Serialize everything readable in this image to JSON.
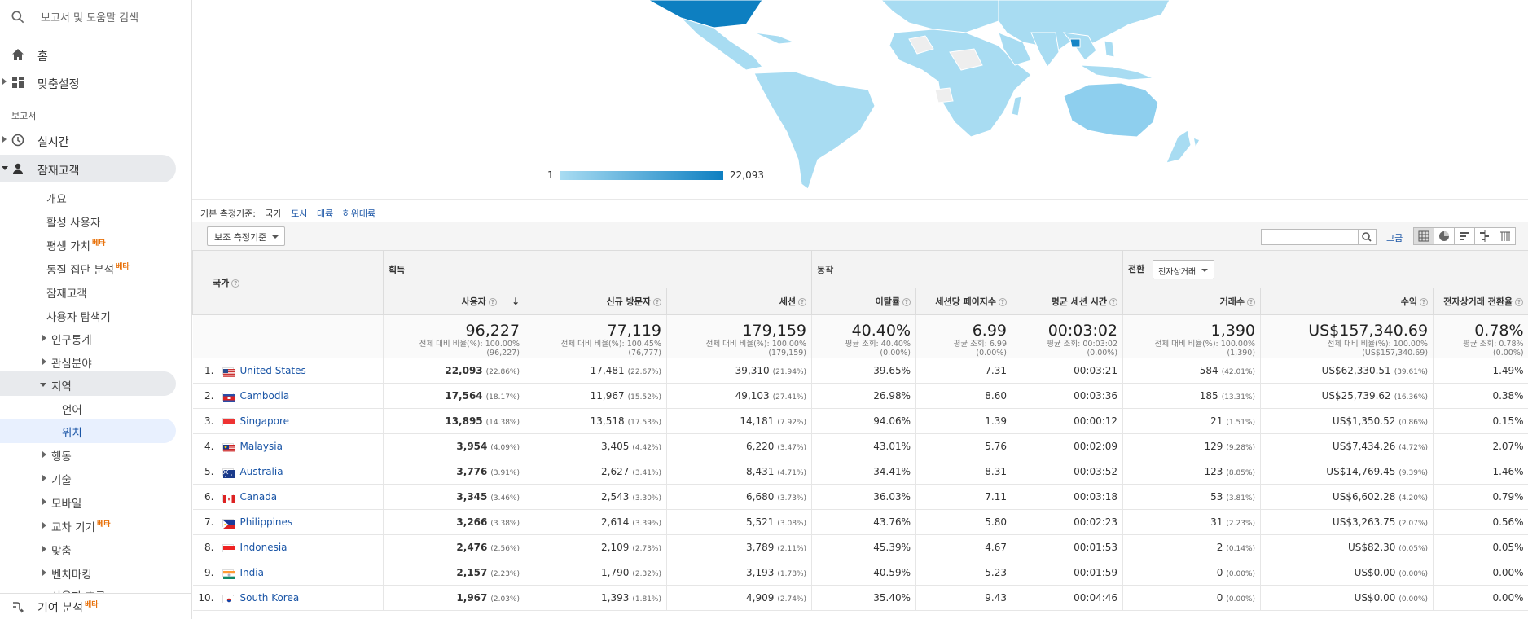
{
  "sidebar": {
    "search_placeholder": "보고서 및 도움말 검색",
    "home": "홈",
    "customization": "맞춤설정",
    "reports_section": "보고서",
    "realtime": "실시간",
    "audience": "잠재고객",
    "audience_items": [
      {
        "label": "개요"
      },
      {
        "label": "활성 사용자"
      },
      {
        "label": "평생 가치",
        "beta": "베타"
      },
      {
        "label": "동질 집단 분석",
        "beta": "베타"
      },
      {
        "label": "잠재고객"
      },
      {
        "label": "사용자 탐색기"
      }
    ],
    "demographics": "인구통계",
    "interests": "관심분야",
    "geo": "지역",
    "language": "언어",
    "location": "위치",
    "behavior": "행동",
    "technology": "기술",
    "mobile": "모바일",
    "cross_device": "교차 기기",
    "cross_device_beta": "베타",
    "custom": "맞춤",
    "benchmarking": "벤치마킹",
    "cutoff_item": "사용자 흐름",
    "attribution": "기여 분석",
    "attribution_beta": "베타"
  },
  "map": {
    "legend_min": "1",
    "legend_max": "22,093",
    "colors": {
      "low": "#a8dcf2",
      "high": "#0d7fc1",
      "nodata": "#eeeeee"
    }
  },
  "dimension_bar": {
    "label": "기본 측정기준:",
    "active": "국가",
    "links": [
      "도시",
      "대륙",
      "하위대륙"
    ]
  },
  "toolbar": {
    "secondary_dim": "보조 측정기준",
    "advanced": "고급"
  },
  "table": {
    "country_header": "국가",
    "groups": {
      "acquisition": "획득",
      "behavior": "동작",
      "conversion": "전환",
      "conversion_select": "전자상거래"
    },
    "columns": [
      "사용자",
      "신규 방문자",
      "세션",
      "이탈률",
      "세션당 페이지수",
      "평균 세션 시간",
      "거래수",
      "수익",
      "전자상거래 전환율"
    ],
    "totals": [
      {
        "big": "96,227",
        "sub1": "전체 대비 비율(%): 100.00%",
        "sub2": "(96,227)"
      },
      {
        "big": "77,119",
        "sub1": "전체 대비 비율(%): 100.45%",
        "sub2": "(76,777)"
      },
      {
        "big": "179,159",
        "sub1": "전체 대비 비율(%): 100.00%",
        "sub2": "(179,159)"
      },
      {
        "big": "40.40%",
        "sub1": "평균 조회: 40.40%",
        "sub2": "(0.00%)"
      },
      {
        "big": "6.99",
        "sub1": "평균 조회: 6.99",
        "sub2": "(0.00%)"
      },
      {
        "big": "00:03:02",
        "sub1": "평균 조회: 00:03:02",
        "sub2": "(0.00%)"
      },
      {
        "big": "1,390",
        "sub1": "전체 대비 비율(%): 100.00%",
        "sub2": "(1,390)"
      },
      {
        "big": "US$157,340.69",
        "sub1": "전체 대비 비율(%): 100.00%",
        "sub2": "(US$157,340.69)"
      },
      {
        "big": "0.78%",
        "sub1": "평균 조회: 0.78%",
        "sub2": "(0.00%)"
      }
    ],
    "rows": [
      {
        "rank": "1.",
        "country": "United States",
        "flag": "us",
        "users": "22,093",
        "users_pct": "(22.86%)",
        "new": "17,481",
        "new_pct": "(22.67%)",
        "sessions": "39,310",
        "sessions_pct": "(21.94%)",
        "bounce": "39.65%",
        "pps": "7.31",
        "dur": "00:03:21",
        "tx": "584",
        "tx_pct": "(42.01%)",
        "rev": "US$62,330.51",
        "rev_pct": "(39.61%)",
        "conv": "1.49%"
      },
      {
        "rank": "2.",
        "country": "Cambodia",
        "flag": "kh",
        "users": "17,564",
        "users_pct": "(18.17%)",
        "new": "11,967",
        "new_pct": "(15.52%)",
        "sessions": "49,103",
        "sessions_pct": "(27.41%)",
        "bounce": "26.98%",
        "pps": "8.60",
        "dur": "00:03:36",
        "tx": "185",
        "tx_pct": "(13.31%)",
        "rev": "US$25,739.62",
        "rev_pct": "(16.36%)",
        "conv": "0.38%"
      },
      {
        "rank": "3.",
        "country": "Singapore",
        "flag": "sg",
        "users": "13,895",
        "users_pct": "(14.38%)",
        "new": "13,518",
        "new_pct": "(17.53%)",
        "sessions": "14,181",
        "sessions_pct": "(7.92%)",
        "bounce": "94.06%",
        "pps": "1.39",
        "dur": "00:00:12",
        "tx": "21",
        "tx_pct": "(1.51%)",
        "rev": "US$1,350.52",
        "rev_pct": "(0.86%)",
        "conv": "0.15%"
      },
      {
        "rank": "4.",
        "country": "Malaysia",
        "flag": "my",
        "users": "3,954",
        "users_pct": "(4.09%)",
        "new": "3,405",
        "new_pct": "(4.42%)",
        "sessions": "6,220",
        "sessions_pct": "(3.47%)",
        "bounce": "43.01%",
        "pps": "5.76",
        "dur": "00:02:09",
        "tx": "129",
        "tx_pct": "(9.28%)",
        "rev": "US$7,434.26",
        "rev_pct": "(4.72%)",
        "conv": "2.07%"
      },
      {
        "rank": "5.",
        "country": "Australia",
        "flag": "au",
        "users": "3,776",
        "users_pct": "(3.91%)",
        "new": "2,627",
        "new_pct": "(3.41%)",
        "sessions": "8,431",
        "sessions_pct": "(4.71%)",
        "bounce": "34.41%",
        "pps": "8.31",
        "dur": "00:03:52",
        "tx": "123",
        "tx_pct": "(8.85%)",
        "rev": "US$14,769.45",
        "rev_pct": "(9.39%)",
        "conv": "1.46%"
      },
      {
        "rank": "6.",
        "country": "Canada",
        "flag": "ca",
        "users": "3,345",
        "users_pct": "(3.46%)",
        "new": "2,543",
        "new_pct": "(3.30%)",
        "sessions": "6,680",
        "sessions_pct": "(3.73%)",
        "bounce": "36.03%",
        "pps": "7.11",
        "dur": "00:03:18",
        "tx": "53",
        "tx_pct": "(3.81%)",
        "rev": "US$6,602.28",
        "rev_pct": "(4.20%)",
        "conv": "0.79%"
      },
      {
        "rank": "7.",
        "country": "Philippines",
        "flag": "ph",
        "users": "3,266",
        "users_pct": "(3.38%)",
        "new": "2,614",
        "new_pct": "(3.39%)",
        "sessions": "5,521",
        "sessions_pct": "(3.08%)",
        "bounce": "43.76%",
        "pps": "5.80",
        "dur": "00:02:23",
        "tx": "31",
        "tx_pct": "(2.23%)",
        "rev": "US$3,263.75",
        "rev_pct": "(2.07%)",
        "conv": "0.56%"
      },
      {
        "rank": "8.",
        "country": "Indonesia",
        "flag": "id",
        "users": "2,476",
        "users_pct": "(2.56%)",
        "new": "2,109",
        "new_pct": "(2.73%)",
        "sessions": "3,789",
        "sessions_pct": "(2.11%)",
        "bounce": "45.39%",
        "pps": "4.67",
        "dur": "00:01:53",
        "tx": "2",
        "tx_pct": "(0.14%)",
        "rev": "US$82.30",
        "rev_pct": "(0.05%)",
        "conv": "0.05%"
      },
      {
        "rank": "9.",
        "country": "India",
        "flag": "in",
        "users": "2,157",
        "users_pct": "(2.23%)",
        "new": "1,790",
        "new_pct": "(2.32%)",
        "sessions": "3,193",
        "sessions_pct": "(1.78%)",
        "bounce": "40.59%",
        "pps": "5.23",
        "dur": "00:01:59",
        "tx": "0",
        "tx_pct": "(0.00%)",
        "rev": "US$0.00",
        "rev_pct": "(0.00%)",
        "conv": "0.00%"
      },
      {
        "rank": "10.",
        "country": "South Korea",
        "flag": "kr",
        "users": "1,967",
        "users_pct": "(2.03%)",
        "new": "1,393",
        "new_pct": "(1.81%)",
        "sessions": "4,909",
        "sessions_pct": "(2.74%)",
        "bounce": "35.40%",
        "pps": "9.43",
        "dur": "00:04:46",
        "tx": "0",
        "tx_pct": "(0.00%)",
        "rev": "US$0.00",
        "rev_pct": "(0.00%)",
        "conv": "0.00%"
      }
    ]
  }
}
